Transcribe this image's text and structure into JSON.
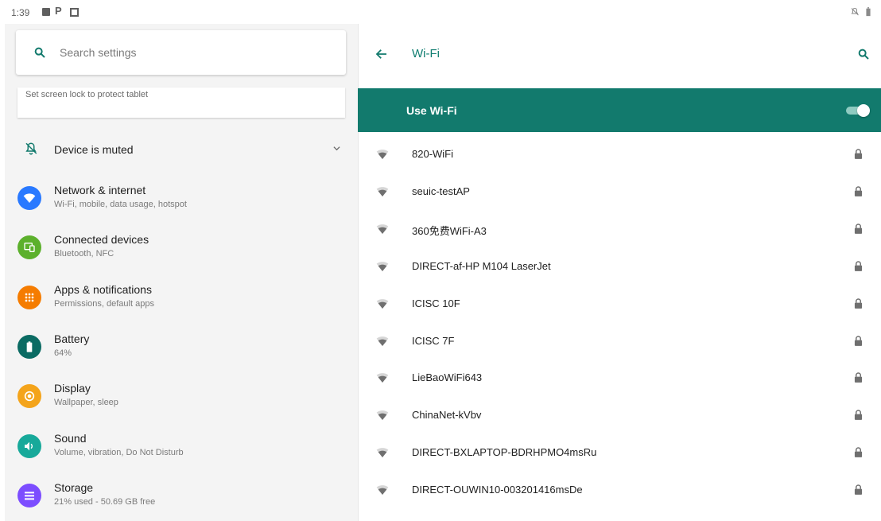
{
  "status_bar": {
    "time": "1:39",
    "p_glyph": "P"
  },
  "search": {
    "placeholder": "Search settings"
  },
  "suggestion": {
    "text": "Set screen lock to protect tablet"
  },
  "condition": {
    "label": "Device is muted"
  },
  "categories": [
    {
      "title": "Network & internet",
      "subtitle": "Wi-Fi, mobile, data usage, hotspot",
      "color": "#2979ff",
      "icon": "wifi-icon"
    },
    {
      "title": "Connected devices",
      "subtitle": "Bluetooth, NFC",
      "color": "#5cb02c",
      "icon": "devices-icon"
    },
    {
      "title": "Apps & notifications",
      "subtitle": "Permissions, default apps",
      "color": "#f57c00",
      "icon": "apps-icon"
    },
    {
      "title": "Battery",
      "subtitle": "64%",
      "color": "#0b6b63",
      "icon": "battery-icon"
    },
    {
      "title": "Display",
      "subtitle": "Wallpaper, sleep",
      "color": "#f4a41b",
      "icon": "display-icon"
    },
    {
      "title": "Sound",
      "subtitle": "Volume, vibration, Do Not Disturb",
      "color": "#17a99a",
      "icon": "sound-icon"
    },
    {
      "title": "Storage",
      "subtitle": "21% used - 50.69 GB free",
      "color": "#7c4dff",
      "icon": "storage-icon"
    }
  ],
  "wifi": {
    "title": "Wi-Fi",
    "use_wifi_label": "Use Wi-Fi",
    "use_wifi_on": true,
    "accent": "#127a6d",
    "networks": [
      {
        "name": "820-WiFi"
      },
      {
        "name": "seuic-testAP"
      },
      {
        "name": "360免费WiFi-A3"
      },
      {
        "name": "DIRECT-af-HP M104 LaserJet"
      },
      {
        "name": "ICISC 10F"
      },
      {
        "name": "ICISC 7F"
      },
      {
        "name": "LieBaoWiFi643"
      },
      {
        "name": "ChinaNet-kVbv"
      },
      {
        "name": "DIRECT-BXLAPTOP-BDRHPMO4msRu"
      },
      {
        "name": "DIRECT-OUWIN10-003201416msDe"
      }
    ]
  }
}
